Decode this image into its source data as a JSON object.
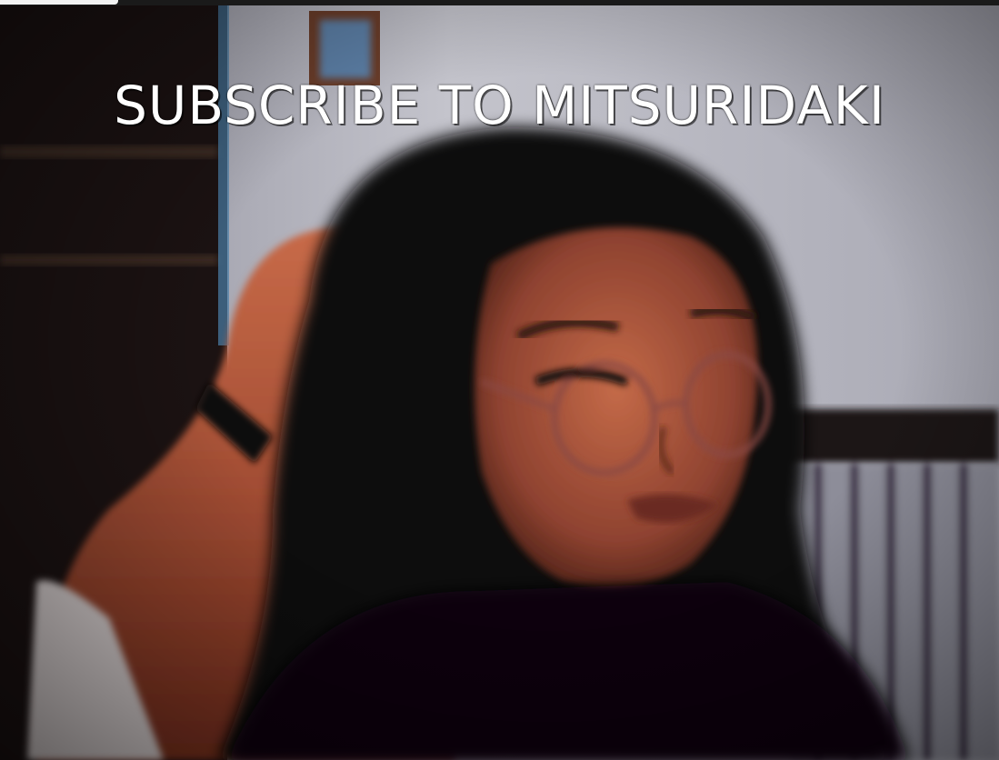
{
  "overlay": {
    "caption": "SUBSCRIBE TO MITSURIDAKI"
  },
  "colors": {
    "wall": "#b9b9c4",
    "chair": "#c65a3a",
    "hair": "#0b0709",
    "skin": "#b05a3e",
    "background_dark": "#120c0c",
    "railing": "#7a7a88"
  }
}
